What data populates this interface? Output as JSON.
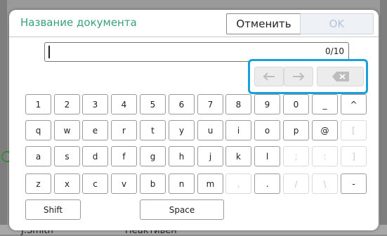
{
  "background": {
    "user_name": "J.Smith",
    "status": "Неактивен"
  },
  "dialog": {
    "title": "Название документа",
    "cancel_label": "Отменить",
    "ok_label": "OK",
    "input_value": "",
    "counter": "0/10"
  },
  "edit_buttons": {
    "left_icon": "arrow-left-icon",
    "right_icon": "arrow-right-icon",
    "backspace_icon": "backspace-icon"
  },
  "keyboard": {
    "row1": [
      {
        "label": "1",
        "enabled": true
      },
      {
        "label": "2",
        "enabled": true
      },
      {
        "label": "3",
        "enabled": true
      },
      {
        "label": "4",
        "enabled": true
      },
      {
        "label": "5",
        "enabled": true
      },
      {
        "label": "6",
        "enabled": true
      },
      {
        "label": "7",
        "enabled": true
      },
      {
        "label": "8",
        "enabled": true
      },
      {
        "label": "9",
        "enabled": true
      },
      {
        "label": "0",
        "enabled": true
      },
      {
        "label": "_",
        "enabled": true
      },
      {
        "label": "^",
        "enabled": true
      }
    ],
    "row2": [
      {
        "label": "q",
        "enabled": true
      },
      {
        "label": "w",
        "enabled": true
      },
      {
        "label": "e",
        "enabled": true
      },
      {
        "label": "r",
        "enabled": true
      },
      {
        "label": "t",
        "enabled": true
      },
      {
        "label": "y",
        "enabled": true
      },
      {
        "label": "u",
        "enabled": true
      },
      {
        "label": "i",
        "enabled": true
      },
      {
        "label": "o",
        "enabled": true
      },
      {
        "label": "p",
        "enabled": true
      },
      {
        "label": "@",
        "enabled": true
      },
      {
        "label": "[",
        "enabled": false
      }
    ],
    "row3": [
      {
        "label": "a",
        "enabled": true
      },
      {
        "label": "s",
        "enabled": true
      },
      {
        "label": "d",
        "enabled": true
      },
      {
        "label": "f",
        "enabled": true
      },
      {
        "label": "g",
        "enabled": true
      },
      {
        "label": "h",
        "enabled": true
      },
      {
        "label": "j",
        "enabled": true
      },
      {
        "label": "k",
        "enabled": true
      },
      {
        "label": "l",
        "enabled": true
      },
      {
        "label": ";",
        "enabled": false
      },
      {
        "label": ":",
        "enabled": false
      },
      {
        "label": "]",
        "enabled": false
      }
    ],
    "row4": [
      {
        "label": "z",
        "enabled": true
      },
      {
        "label": "x",
        "enabled": true
      },
      {
        "label": "c",
        "enabled": true
      },
      {
        "label": "v",
        "enabled": true
      },
      {
        "label": "b",
        "enabled": true
      },
      {
        "label": "n",
        "enabled": true
      },
      {
        "label": "m",
        "enabled": true
      },
      {
        "label": ",",
        "enabled": false
      },
      {
        "label": ".",
        "enabled": true
      },
      {
        "label": "/",
        "enabled": false
      },
      {
        "label": "\\",
        "enabled": false
      },
      {
        "label": "-",
        "enabled": true
      }
    ],
    "shift_label": "Shift",
    "space_label": "Space"
  },
  "colors": {
    "title": "#3aa07a",
    "focus_border": "#1aa0d8",
    "ok_disabled": "#b4c4d4"
  }
}
